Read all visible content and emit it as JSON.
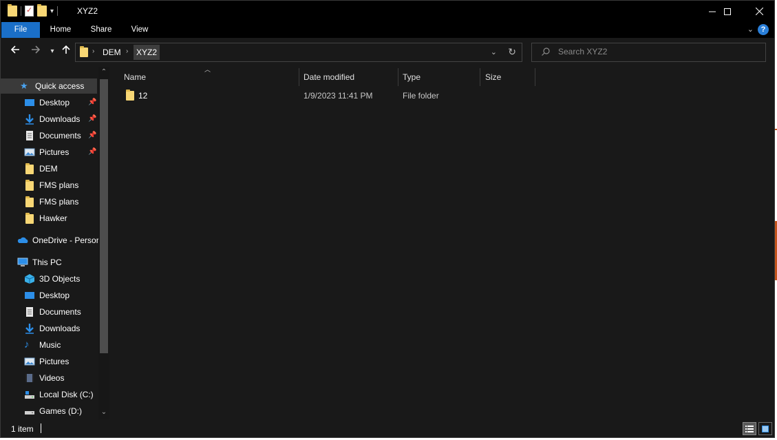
{
  "window": {
    "title": "XYZ2",
    "controls": [
      "minimize",
      "maximize",
      "close"
    ]
  },
  "ribbon": {
    "tabs": [
      {
        "label": "File",
        "active": true
      },
      {
        "label": "Home"
      },
      {
        "label": "Share"
      },
      {
        "label": "View"
      }
    ],
    "help_label": "?"
  },
  "address": {
    "crumbs": [
      "DEM",
      "XYZ2"
    ]
  },
  "search": {
    "placeholder": "Search XYZ2"
  },
  "nav": {
    "quick_access": {
      "label": "Quick access",
      "items": [
        {
          "label": "Desktop",
          "icon": "desktop-icon",
          "pinned": true
        },
        {
          "label": "Downloads",
          "icon": "downloads-icon",
          "pinned": true
        },
        {
          "label": "Documents",
          "icon": "documents-icon",
          "pinned": true
        },
        {
          "label": "Pictures",
          "icon": "pictures-icon",
          "pinned": true
        },
        {
          "label": "DEM",
          "icon": "folder-icon"
        },
        {
          "label": "FMS plans",
          "icon": "folder-icon"
        },
        {
          "label": "FMS plans",
          "icon": "folder-icon"
        },
        {
          "label": "Hawker",
          "icon": "folder-icon"
        }
      ]
    },
    "onedrive": {
      "label": "OneDrive - Persor"
    },
    "this_pc": {
      "label": "This PC",
      "items": [
        {
          "label": "3D Objects",
          "icon": "3d-objects-icon"
        },
        {
          "label": "Desktop",
          "icon": "desktop-icon"
        },
        {
          "label": "Documents",
          "icon": "documents-icon"
        },
        {
          "label": "Downloads",
          "icon": "downloads-icon"
        },
        {
          "label": "Music",
          "icon": "music-icon"
        },
        {
          "label": "Pictures",
          "icon": "pictures-icon"
        },
        {
          "label": "Videos",
          "icon": "videos-icon"
        },
        {
          "label": "Local Disk (C:)",
          "icon": "drive-icon"
        },
        {
          "label": "Games (D:)",
          "icon": "drive-icon"
        }
      ]
    }
  },
  "filelist": {
    "columns": [
      "Name",
      "Date modified",
      "Type",
      "Size"
    ],
    "rows": [
      {
        "name": "12",
        "date": "1/9/2023 11:41 PM",
        "type": "File folder",
        "size": ""
      }
    ]
  },
  "status": {
    "count": "1 item"
  },
  "colors": {
    "window_bg": "#191919",
    "titlebar_bg": "#000000",
    "accent": "#1a6fc8",
    "folder": "#f8d775"
  }
}
